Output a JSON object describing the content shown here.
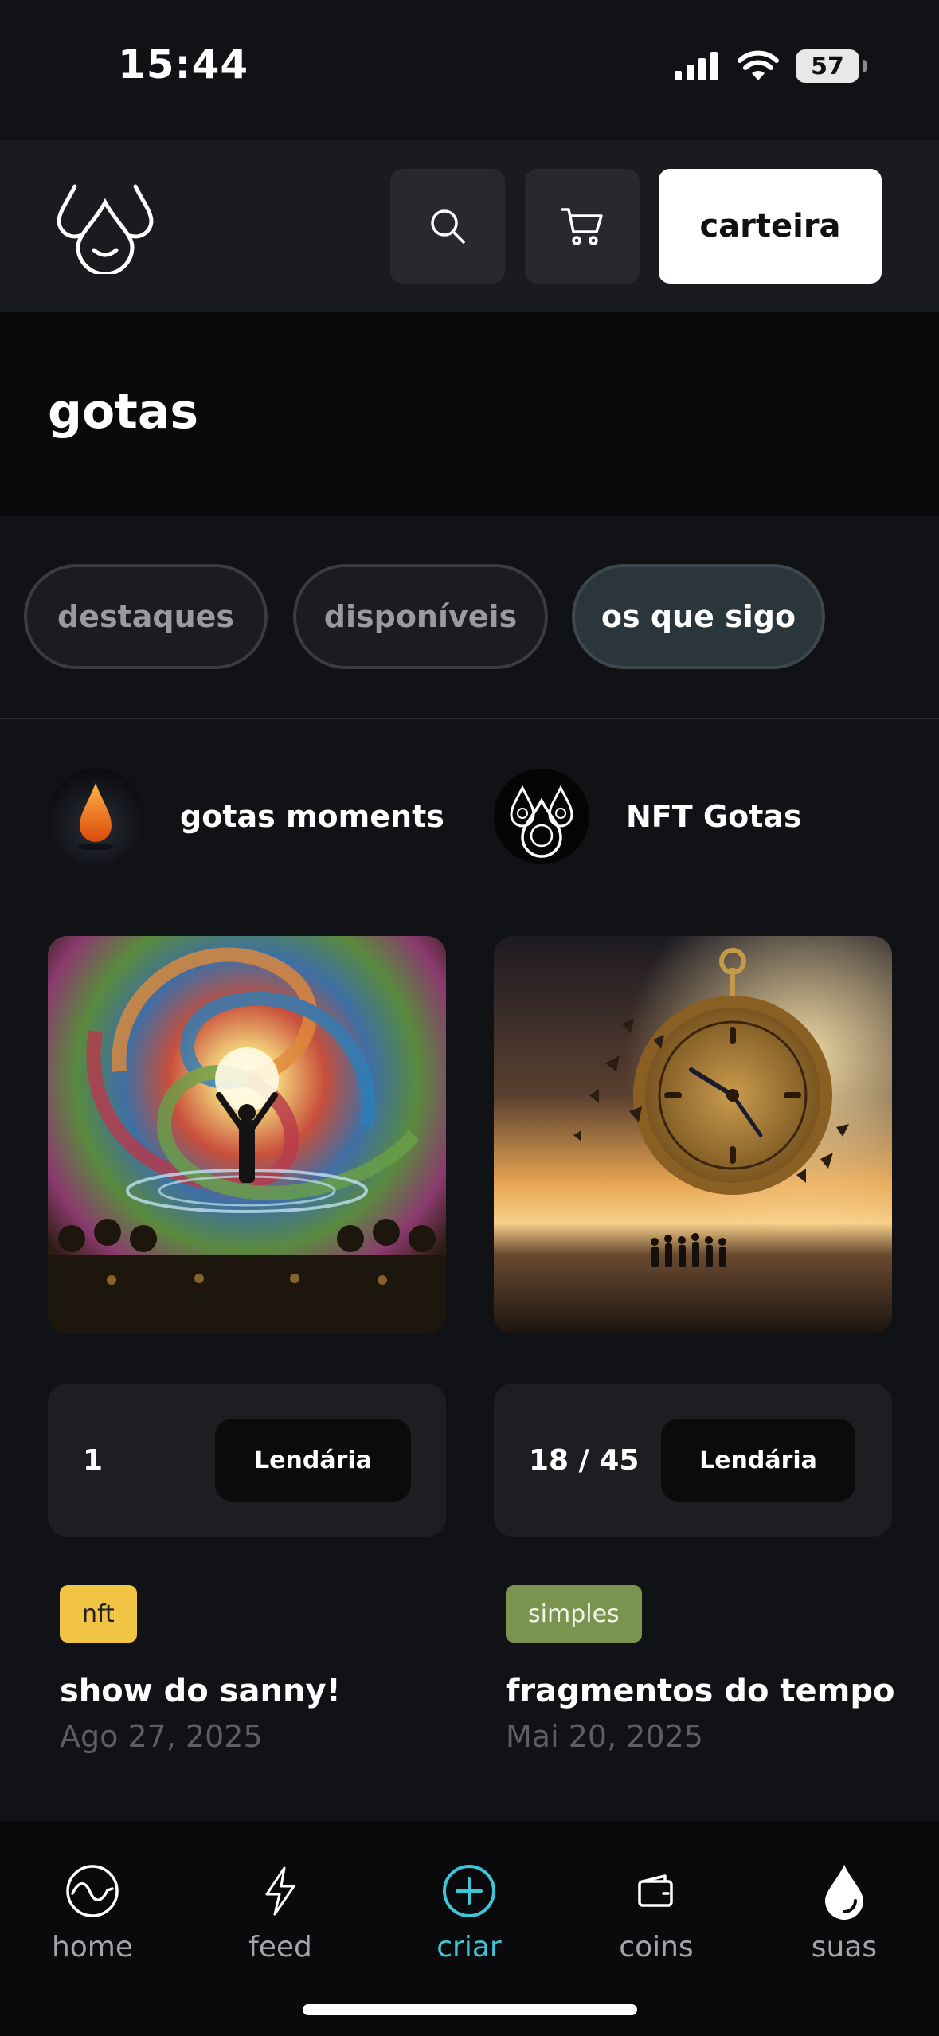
{
  "status_bar": {
    "time": "15:44",
    "battery": "57"
  },
  "header": {
    "logo_icon": "water-drops-logo-icon",
    "search_icon": "search-icon",
    "cart_icon": "cart-icon",
    "wallet_label": "carteira"
  },
  "page": {
    "title": "gotas"
  },
  "filters": [
    {
      "label": "destaques",
      "active": false
    },
    {
      "label": "disponíveis",
      "active": false
    },
    {
      "label": "os que sigo",
      "active": true
    }
  ],
  "cards": [
    {
      "creator": "gotas moments",
      "artwork": "stained-glass-spiral-concert-image",
      "edition": "1",
      "rarity": "Lendária",
      "tag": "nft",
      "tag_color": "#f2c443",
      "title": "show do sanny!",
      "date": "Ago 27, 2025"
    },
    {
      "creator": "NFT Gotas",
      "artwork": "shattered-pocket-watch-sunset-image",
      "edition": "18 / 45",
      "rarity": "Lendária",
      "tag": "simples",
      "tag_color": "#7a9450",
      "title": "fragmentos do tempo",
      "date": "Mai 20, 2025"
    }
  ],
  "nav": [
    {
      "label": "home",
      "icon": "wave-circle-icon",
      "active": false
    },
    {
      "label": "feed",
      "icon": "lightning-icon",
      "active": false
    },
    {
      "label": "criar",
      "icon": "plus-circle-icon",
      "active": true
    },
    {
      "label": "coins",
      "icon": "wallet-icon",
      "active": false
    },
    {
      "label": "suas",
      "icon": "drop-icon",
      "active": false
    }
  ],
  "colors": {
    "accent": "#3fc5d8",
    "background": "#111216",
    "card": "#1d1e21"
  }
}
